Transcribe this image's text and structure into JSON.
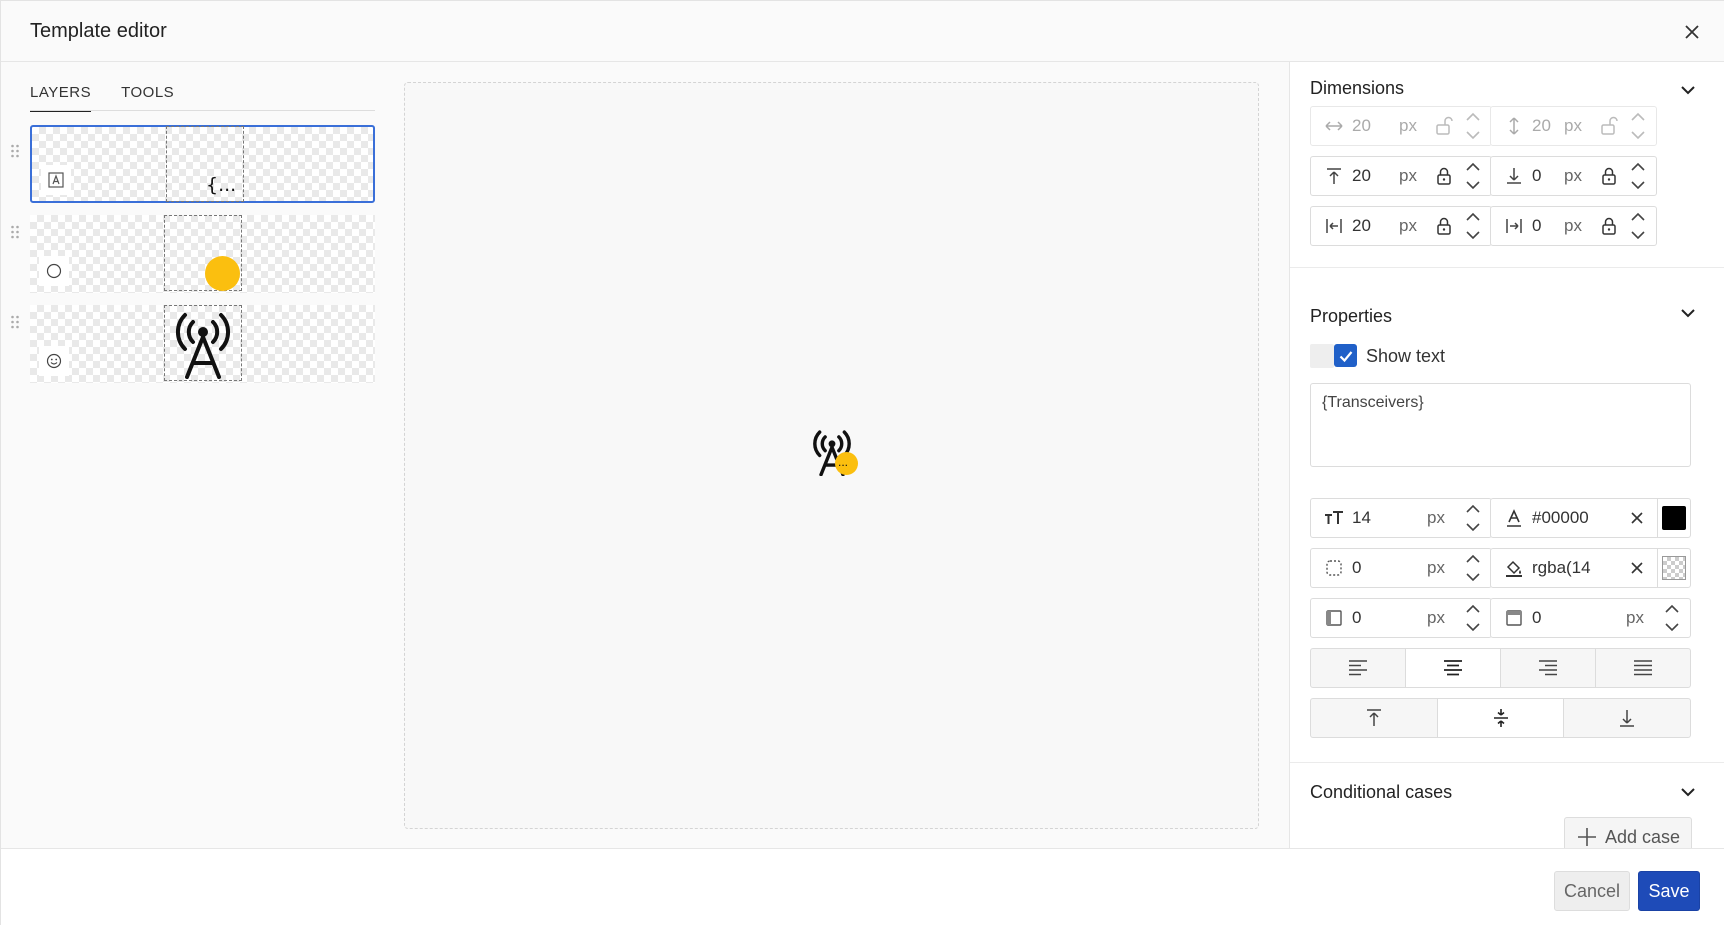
{
  "header": {
    "title": "Template editor"
  },
  "tabs": [
    {
      "label": "LAYERS"
    },
    {
      "label": "TOOLS"
    }
  ],
  "layers": [
    {
      "text_preview": "{..."
    },
    {
      "text_preview": ""
    },
    {
      "text_preview": ""
    }
  ],
  "canvas": {
    "label_preview": "..."
  },
  "dimensions": {
    "title": "Dimensions",
    "width": {
      "value": "20",
      "unit": "px"
    },
    "height": {
      "value": "20",
      "unit": "px"
    },
    "top": {
      "value": "20",
      "unit": "px"
    },
    "bottom": {
      "value": "0",
      "unit": "px"
    },
    "left": {
      "value": "20",
      "unit": "px"
    },
    "right": {
      "value": "0",
      "unit": "px"
    }
  },
  "properties": {
    "title": "Properties",
    "show_text_label": "Show text",
    "show_text_checked": true,
    "text_value": "{Transceivers}",
    "font_size": {
      "value": "14",
      "unit": "px"
    },
    "text_color": {
      "value": "#00000",
      "swatch": "#000000"
    },
    "border_radius": {
      "value": "0",
      "unit": "px"
    },
    "fill_color": {
      "value": "rgba(14"
    },
    "padding_h": {
      "value": "0",
      "unit": "px"
    },
    "padding_v": {
      "value": "0",
      "unit": "px"
    },
    "h_align_selected": "center",
    "v_align_selected": "middle"
  },
  "conditional": {
    "title": "Conditional cases",
    "add_label": "Add case"
  },
  "footer": {
    "cancel_label": "Cancel",
    "save_label": "Save"
  },
  "colors": {
    "accent": "#1e4bb8",
    "selection": "#3a6fd8",
    "dot": "#fbbf0f"
  }
}
